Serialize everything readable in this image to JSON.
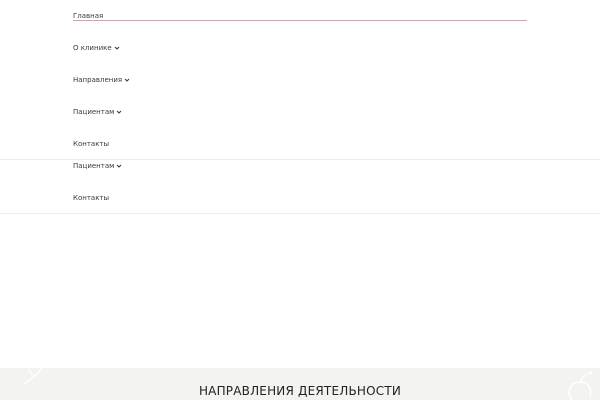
{
  "nav": {
    "home": "Главная",
    "about": "О клинике",
    "directions": "Направления",
    "patients": "Пациентам",
    "contacts": "Контакты"
  },
  "nav_overlay": {
    "patients": "Пациентам",
    "contacts": "Контакты"
  },
  "section": {
    "title": "НАПРАВЛЕНИЯ ДЕЯТЕЛЬНОСТИ"
  },
  "icons": {
    "dropdown": "chevron-down-icon"
  },
  "colors": {
    "active_underline": "#c9a9b3",
    "section_bg": "#f3f3f2",
    "divider": "#ececec"
  }
}
